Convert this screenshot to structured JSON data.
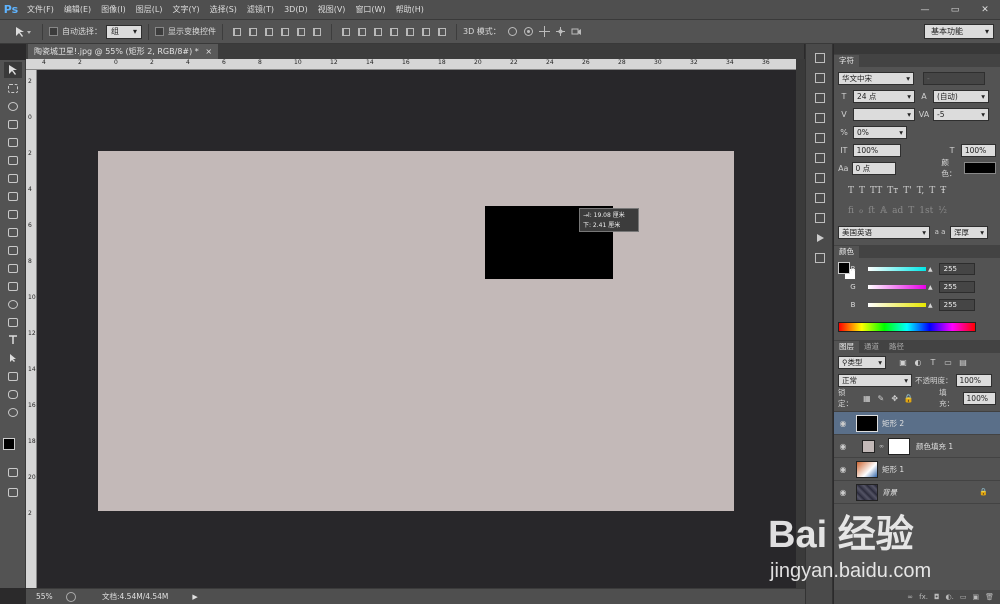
{
  "app": {
    "logo": "Ps"
  },
  "menu": [
    "文件(F)",
    "编辑(E)",
    "图像(I)",
    "图层(L)",
    "文字(Y)",
    "选择(S)",
    "滤镜(T)",
    "3D(D)",
    "视图(V)",
    "窗口(W)",
    "帮助(H)"
  ],
  "window_controls": {
    "minimize": "—",
    "restore": "▭",
    "close": "✕"
  },
  "options": {
    "auto_select_label": "自动选择：",
    "auto_select_value": "组",
    "show_transform_label": "显示变换控件",
    "mode_3d_label": "3D 模式：",
    "workspace": "基本功能"
  },
  "document": {
    "tab_title": "陶瓷城卫星!.jpg @ 55% (矩形 2, RGB/8#) *",
    "tab_close": "×"
  },
  "ruler": {
    "h": [
      "4",
      "2",
      "0",
      "2",
      "4",
      "6",
      "8",
      "10",
      "12",
      "14",
      "16",
      "18",
      "20",
      "22",
      "24",
      "26",
      "28",
      "30",
      "32",
      "34",
      "36",
      "38"
    ],
    "v": [
      "2",
      "0",
      "2",
      "4",
      "6",
      "8",
      "10",
      "12",
      "14",
      "16",
      "18",
      "20",
      "2"
    ]
  },
  "transform_tip": {
    "line1": "→l: 19.08 厘米",
    "line2": "下: 2.41 厘米"
  },
  "status": {
    "zoom": "55%",
    "doc": "文档:4.54M/4.54M",
    "arrow": "▶"
  },
  "char_panel": {
    "tab": "字符",
    "font_family": "华文中宋",
    "font_style": "-",
    "font_size": "24 点",
    "leading": "(自动)",
    "kerning": "",
    "tracking": "-5",
    "scale_pct": "0%",
    "vscale": "100%",
    "hscale": "100%",
    "baseline": "0 点",
    "color_label": "颜色：",
    "styles": [
      "T",
      "T",
      "TT",
      "Tт",
      "T'",
      "T,",
      "T",
      "Ŧ"
    ],
    "styles2": [
      "fi",
      "ℴ",
      "ﬅ",
      "𝔸",
      "ad",
      "T",
      "1st",
      "½"
    ],
    "language": "美国英语",
    "aa_label": "a a",
    "antialias": "浑厚"
  },
  "color_panel": {
    "tab": "颜色",
    "channels": [
      {
        "label": "R",
        "value": "255",
        "color": "#00e6e6"
      },
      {
        "label": "G",
        "value": "255",
        "color": "#e600e6"
      },
      {
        "label": "B",
        "value": "255",
        "color": "#e6e600"
      }
    ]
  },
  "layers_panel": {
    "tabs": [
      "图层",
      "通道",
      "路径"
    ],
    "filter": "类型",
    "blend_mode": "正常",
    "opacity_label": "不透明度：",
    "opacity": "100%",
    "lock_label": "锁定：",
    "fill_label": "填充：",
    "fill": "100%",
    "layers": [
      {
        "name": "矩形 2",
        "selected": true
      },
      {
        "name": "颜色填充 1",
        "selected": false
      },
      {
        "name": "矩形 1",
        "selected": false
      },
      {
        "name": "背景",
        "selected": false
      }
    ],
    "footer": [
      "∞",
      "fx.",
      "◘",
      "◐.",
      "▭",
      "▣",
      "🗑"
    ]
  },
  "colors": {
    "canvas": "#c3b9b8",
    "selection": "#5a6f89",
    "ps_blue": "#5fb4ff"
  },
  "watermark": {
    "brand": "Bai 经验",
    "url": "jingyan.baidu.com"
  }
}
